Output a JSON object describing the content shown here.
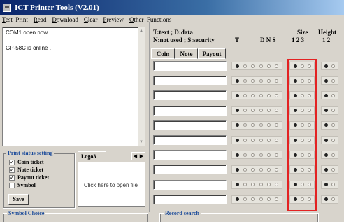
{
  "window": {
    "title": "ICT Printer Tools (V2.01)"
  },
  "menu": [
    "Test_Print",
    "Read",
    "Download",
    "Clear",
    "Preview",
    "Other_Functions"
  ],
  "log": {
    "lines": [
      "COM1  open now",
      "GP-58C is online ."
    ]
  },
  "print_status": {
    "title": "Print status setting",
    "items": [
      {
        "label": "Coin ticket",
        "checked": true
      },
      {
        "label": "Note ticket",
        "checked": true
      },
      {
        "label": "Payout ticket",
        "checked": true
      },
      {
        "label": "Symbol",
        "checked": false
      }
    ],
    "save_label": "Save"
  },
  "logo": {
    "tab_label": "Logo3",
    "panel_text": "Click here to open file",
    "prev_arrow": "◀",
    "next_arrow": "▶"
  },
  "bottom": {
    "symbol_title": "Symbol Choice",
    "record_title": "Record search"
  },
  "legend": {
    "line1": "T:text ; D:data",
    "line2": "N:not used ; S:security"
  },
  "columns": {
    "type_header": "T",
    "dns_header": "D N S",
    "size_header": "Size",
    "size_sub": "1  2  3",
    "height_header": "Height",
    "height_sub": "1  2"
  },
  "tabs": [
    "Coin",
    "Note",
    "Payout"
  ],
  "rows": [
    {
      "text": "",
      "type": "T",
      "size": 1,
      "height": 1
    },
    {
      "text": "",
      "type": "T",
      "size": 1,
      "height": 1
    },
    {
      "text": "",
      "type": "T",
      "size": 1,
      "height": 1
    },
    {
      "text": "",
      "type": "T",
      "size": 1,
      "height": 1
    },
    {
      "text": "",
      "type": "T",
      "size": 1,
      "height": 1
    },
    {
      "text": "",
      "type": "T",
      "size": 1,
      "height": 1
    },
    {
      "text": "",
      "type": "T",
      "size": 1,
      "height": 1
    },
    {
      "text": "",
      "type": "T",
      "size": 1,
      "height": 1
    },
    {
      "text": "",
      "type": "T",
      "size": 1,
      "height": 1
    },
    {
      "text": "",
      "type": "T",
      "size": 1,
      "height": 1
    }
  ],
  "colors": {
    "highlight": "#e32222",
    "group_title": "#1a4a9a",
    "titlebar": "#0a246a"
  }
}
